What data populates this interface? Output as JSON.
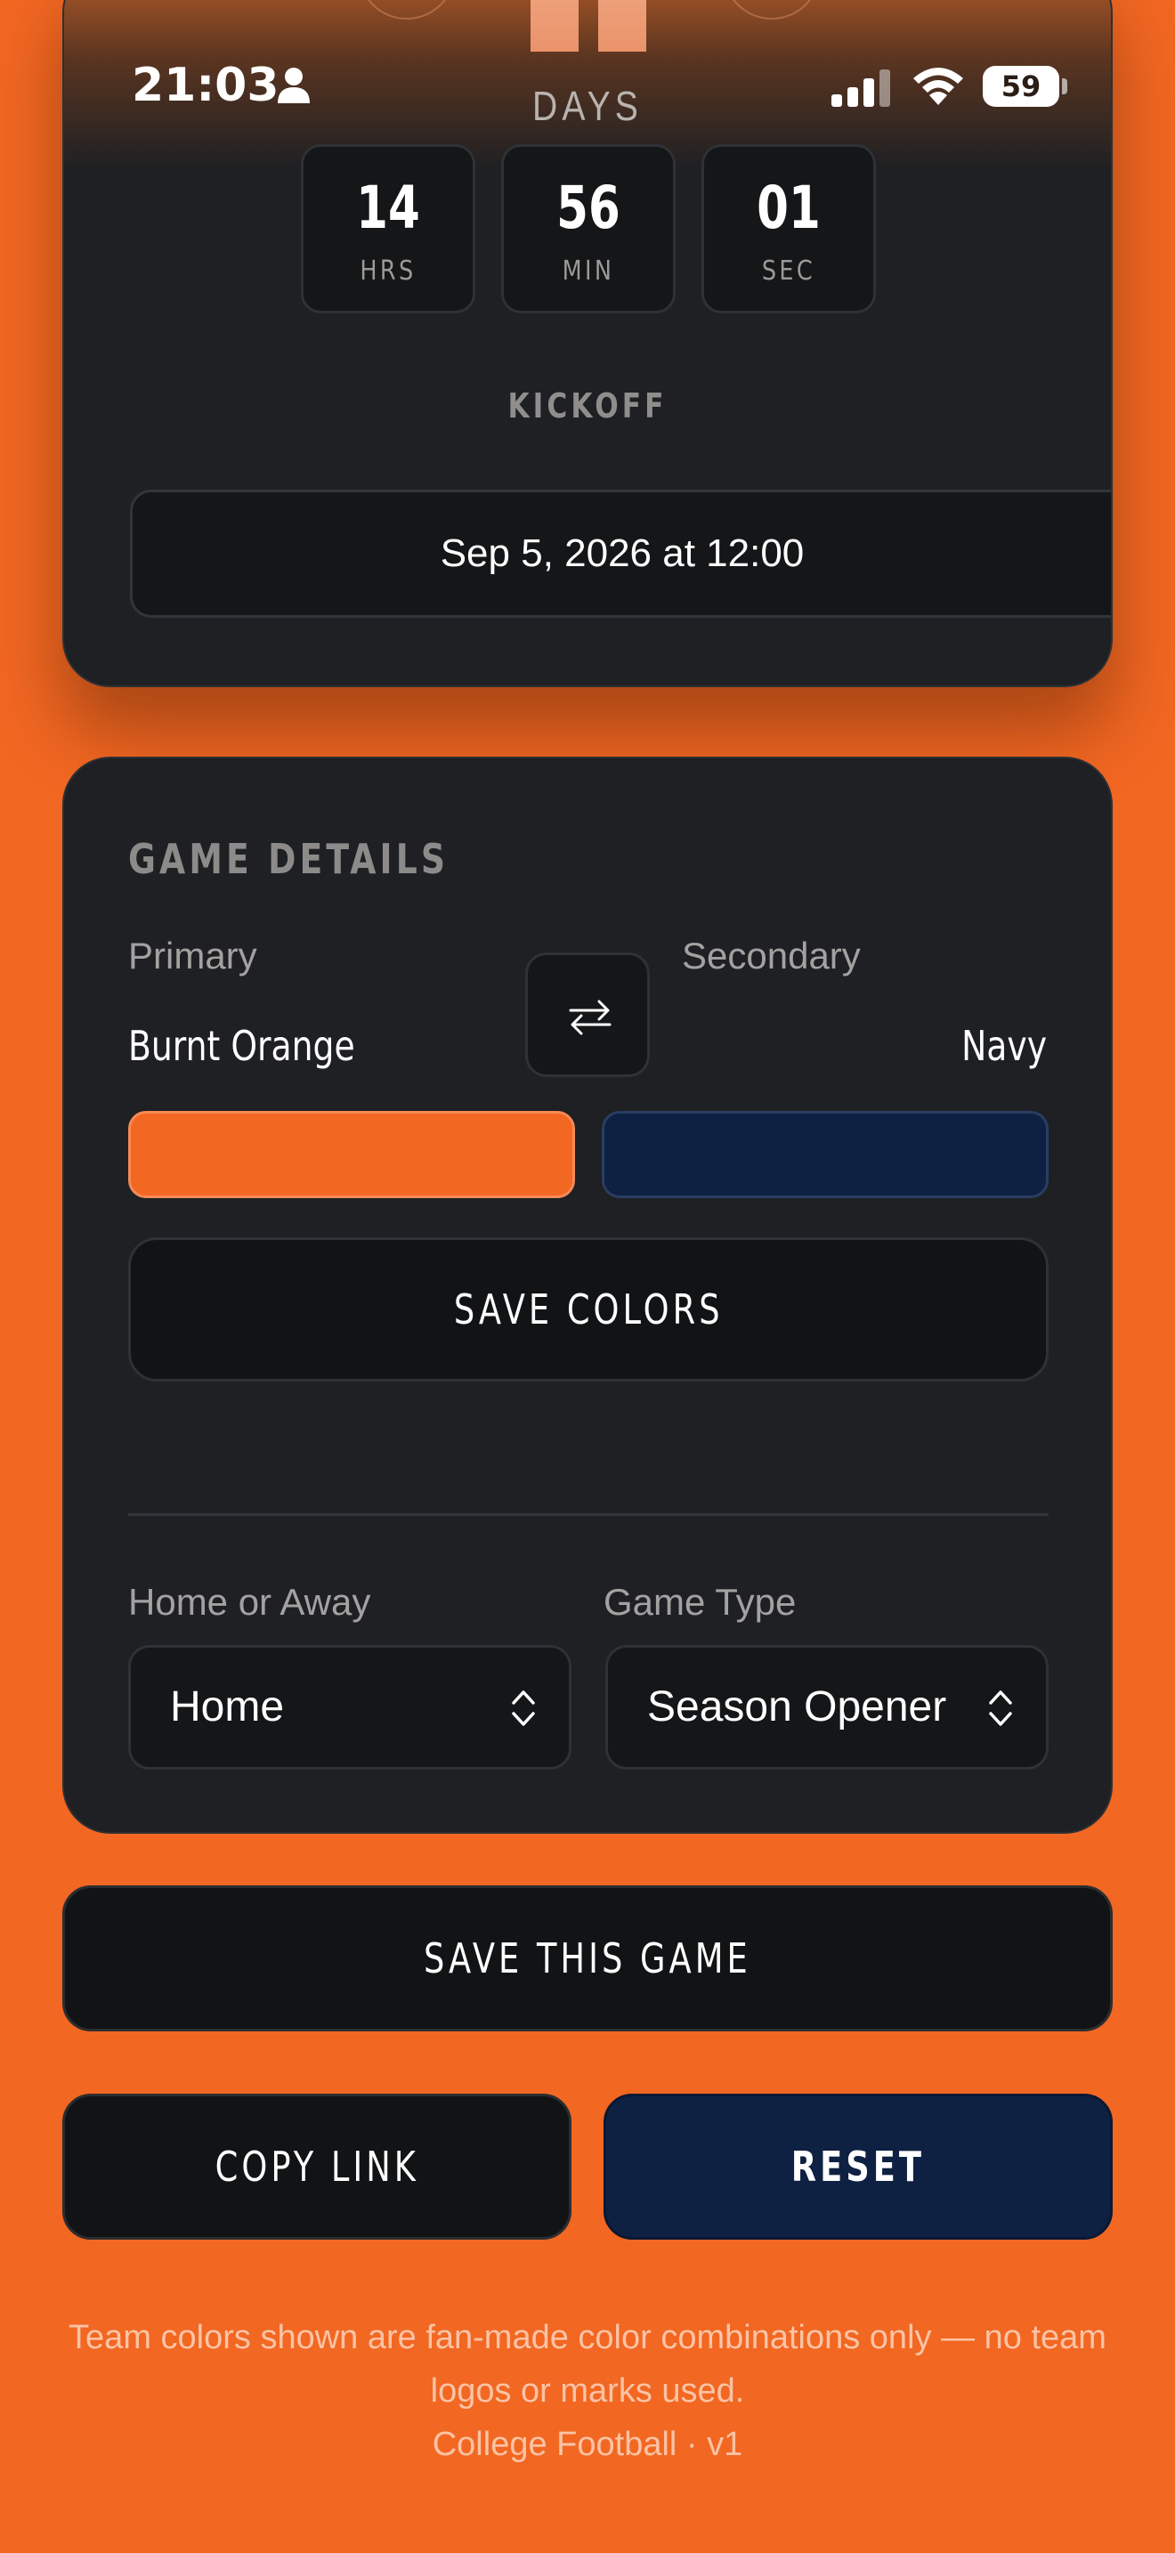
{
  "status_bar": {
    "time": "21:03",
    "battery": "59",
    "battery_level": 0.59,
    "icons": [
      "person-icon",
      "signal-icon",
      "wifi-icon",
      "battery-icon"
    ]
  },
  "countdown": {
    "days_label": "DAYS",
    "hours": "14",
    "hours_unit": "HRS",
    "minutes": "56",
    "minutes_unit": "MIN",
    "seconds": "01",
    "seconds_unit": "SEC",
    "kickoff_label": "KICKOFF",
    "kickoff_value": "Sep 5, 2026 at 12:00"
  },
  "details": {
    "title": "GAME DETAILS",
    "primary_label": "Primary",
    "primary_name": "Burnt Orange",
    "primary_color": "#f26722",
    "secondary_label": "Secondary",
    "secondary_name": "Navy",
    "secondary_color": "#0e2142",
    "swap_icon": "swap-arrows-icon",
    "save_colors_label": "SAVE COLORS",
    "home_away_label": "Home or Away",
    "home_away_value": "Home",
    "game_type_label": "Game Type",
    "game_type_value": "Season Opener"
  },
  "actions": {
    "save_game_label": "SAVE THIS GAME",
    "copy_link_label": "COPY LINK",
    "reset_label": "RESET"
  },
  "footer": {
    "disclaimer": "Team colors shown are fan-made color combinations only — no team logos or marks used.",
    "version": "College Football · v1"
  },
  "colors": {
    "background": "#f26722",
    "card": "#1e2023",
    "accent_navy": "#0e2142"
  }
}
